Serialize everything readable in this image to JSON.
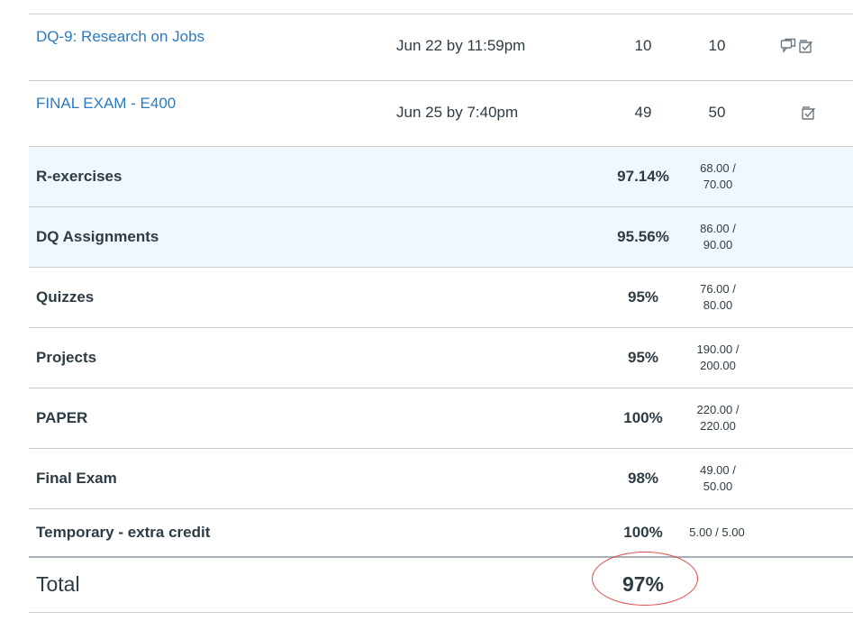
{
  "assignments": [
    {
      "name": "DQ-9: Research on Jobs",
      "due": "Jun 22 by 11:59pm",
      "score": "10",
      "out_of": "10",
      "icons": [
        "comment-icon",
        "rubric-icon"
      ]
    },
    {
      "name": "FINAL EXAM - E400",
      "due": "Jun 25 by 7:40pm",
      "score": "49",
      "out_of": "50",
      "icons": [
        "rubric-icon"
      ]
    }
  ],
  "categories": [
    {
      "name": "R-exercises",
      "percent": "97.14%",
      "frac_top": "68.00 /",
      "frac_bottom": "70.00"
    },
    {
      "name": "DQ Assignments",
      "percent": "95.56%",
      "frac_top": "86.00 /",
      "frac_bottom": "90.00"
    },
    {
      "name": "Quizzes",
      "percent": "95%",
      "frac_top": "76.00 /",
      "frac_bottom": "80.00"
    },
    {
      "name": "Projects",
      "percent": "95%",
      "frac_top": "190.00 /",
      "frac_bottom": "200.00"
    },
    {
      "name": "PAPER",
      "percent": "100%",
      "frac_top": "220.00 /",
      "frac_bottom": "220.00"
    },
    {
      "name": "Final Exam",
      "percent": "98%",
      "frac_top": "49.00 /",
      "frac_bottom": "50.00"
    },
    {
      "name": "Temporary - extra credit",
      "percent": "100%",
      "frac_single": "5.00 / 5.00"
    }
  ],
  "total": {
    "label": "Total",
    "percent": "97%"
  },
  "colors": {
    "link": "#2b7abc",
    "text": "#2d3b45",
    "border": "#c7cdd1",
    "shaded_row": "#f1f8fd",
    "annotation_circle": "#e04848"
  }
}
